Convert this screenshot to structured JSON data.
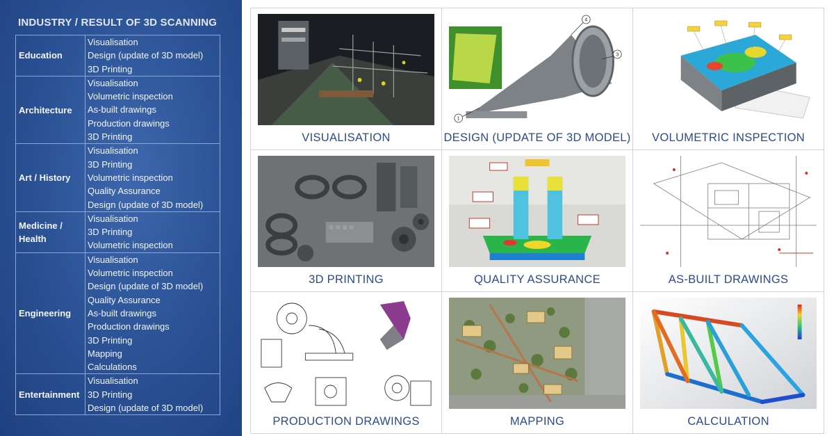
{
  "panel": {
    "title": "INDUSTRY / RESULT OF 3D SCANNING",
    "rows": [
      {
        "industry": "Education",
        "results": [
          "Visualisation",
          "Design (update of 3D model)",
          "3D Printing"
        ]
      },
      {
        "industry": "Architecture",
        "results": [
          "Visualisation",
          "Volumetric inspection",
          "As-built drawings",
          "Production drawings",
          "3D Printing"
        ]
      },
      {
        "industry": "Art / History",
        "results": [
          "Visualisation",
          "3D Printing",
          "Volumetric inspection",
          "Quality Assurance",
          "Design (update of 3D model)"
        ]
      },
      {
        "industry": "Medicine / Health",
        "results": [
          "Visualisation",
          "3D Printing",
          "Volumetric inspection"
        ]
      },
      {
        "industry": "Engineering",
        "results": [
          "Visualisation",
          "Volumetric inspection",
          "Design (update of 3D model)",
          "Quality Assurance",
          "As-built drawings",
          "Production drawings",
          "3D Printing",
          "Mapping",
          "Calculations"
        ]
      },
      {
        "industry": "Entertainment",
        "results": [
          "Visualisation",
          "3D Printing",
          "Design (update of 3D model)"
        ]
      }
    ]
  },
  "grid": [
    {
      "caption": "VISUALISATION",
      "image": "ship-pointcloud-image"
    },
    {
      "caption": "DESIGN (UPDATE OF 3D MODEL)",
      "image": "cone-model-image",
      "callouts": [
        "1",
        "3",
        "4"
      ]
    },
    {
      "caption": "VOLUMETRIC INSPECTION",
      "image": "heatmap-part-image"
    },
    {
      "caption": "3D PRINTING",
      "image": "printed-parts-image"
    },
    {
      "caption": "QUALITY ASSURANCE",
      "image": "qa-deviation-image"
    },
    {
      "caption": "AS-BUILT DRAWINGS",
      "image": "floorplan-image"
    },
    {
      "caption": "PRODUCTION DRAWINGS",
      "image": "technical-drawing-image"
    },
    {
      "caption": "MAPPING",
      "image": "aerial-map-image"
    },
    {
      "caption": "CALCULATION",
      "image": "fea-frame-image"
    }
  ],
  "colors": {
    "panel_blue": "#2c5497",
    "caption_blue": "#2c4a8c"
  }
}
